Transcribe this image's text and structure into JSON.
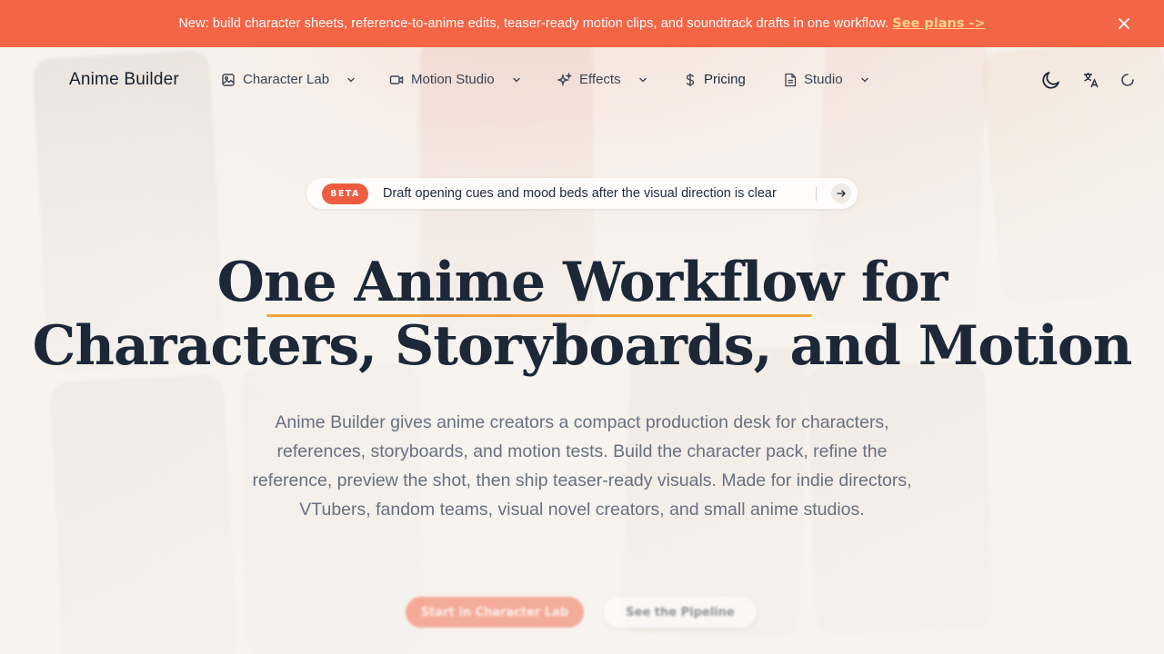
{
  "announcement": {
    "message": "New: build character sheets, reference-to-anime edits, teaser-ready motion clips, and soundtrack drafts in one workflow.",
    "link": "See plans ->",
    "close_icon": "close-icon"
  },
  "nav": {
    "brand": "Anime Builder",
    "items": [
      {
        "label": "Character Lab",
        "icon": "image-icon",
        "has_dropdown": true
      },
      {
        "label": "Motion Studio",
        "icon": "video-camera-icon",
        "has_dropdown": true
      },
      {
        "label": "Effects",
        "icon": "sparkles-icon",
        "has_dropdown": true
      },
      {
        "label": "Pricing",
        "icon": "dollar-icon",
        "has_dropdown": false
      },
      {
        "label": "Studio",
        "icon": "document-icon",
        "has_dropdown": true
      }
    ],
    "right_icons": [
      "moon-icon",
      "translate-icon",
      "loading-spinner-icon"
    ]
  },
  "hero": {
    "badge": "BETA",
    "badge_text": "Draft opening cues and mood beds after the visual direction is clear",
    "headline_line1": "One Anime Workflow for",
    "headline_line2": "Characters, Storyboards, and Motion",
    "description": "Anime Builder gives anime creators a compact production desk for characters, references, storyboards, and motion tests. Build the character pack, refine the reference, preview the shot, then ship teaser-ready visuals. Made for indie directors, VTubers, fandom teams, visual novel creators, and small anime studios.",
    "primary_cta": "Start in Character Lab",
    "secondary_cta": "See the Pipeline"
  },
  "colors": {
    "accent": "#f46546",
    "badge": "#ef5d40",
    "underline": "#f2a33c",
    "link": "#ffd38a",
    "heading": "#1c2838",
    "body_text": "#687080"
  }
}
